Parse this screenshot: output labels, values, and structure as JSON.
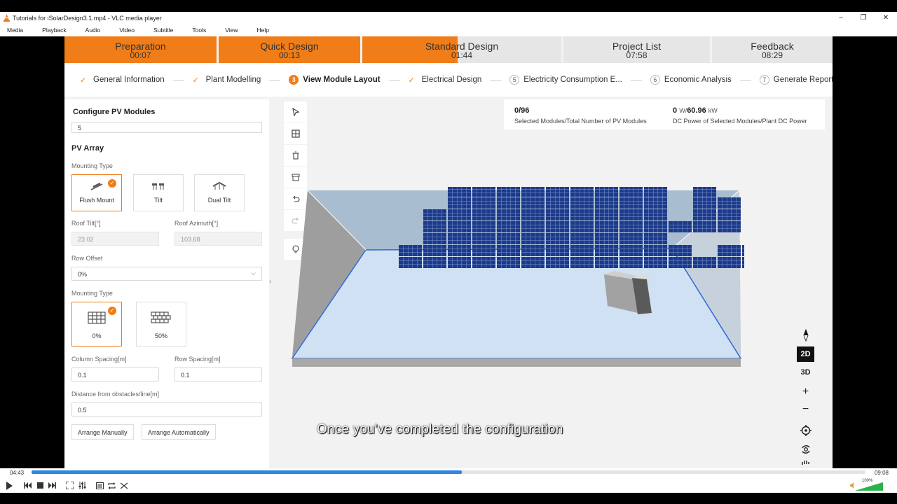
{
  "window": {
    "title": "Tutorials for iSolarDesign3.1.mp4 - VLC media player",
    "controls": [
      "–",
      "❐",
      "✕"
    ]
  },
  "menu": [
    "Media",
    "Playback",
    "Audio",
    "Video",
    "Subtitle",
    "Tools",
    "View",
    "Help"
  ],
  "phases": [
    {
      "label": "Preparation",
      "time": "00:07",
      "progress": 1.0
    },
    {
      "label": "Quick Design",
      "time": "00:13",
      "progress": 1.0
    },
    {
      "label": "Standard Design",
      "time": "01:44",
      "progress": 0.48
    },
    {
      "label": "Project List",
      "time": "07:58",
      "progress": 0
    },
    {
      "label": "Feedback",
      "time": "08:29",
      "progress": 0
    }
  ],
  "steps": [
    {
      "label": "General Information",
      "state": "done",
      "num": ""
    },
    {
      "label": "Plant Modelling",
      "state": "done",
      "num": ""
    },
    {
      "label": "View Module Layout",
      "state": "active",
      "num": "3"
    },
    {
      "label": "Electrical Design",
      "state": "done",
      "num": ""
    },
    {
      "label": "Electricity Consumption E...",
      "state": "todo",
      "num": "5"
    },
    {
      "label": "Economic Analysis",
      "state": "todo",
      "num": "6"
    },
    {
      "label": "Generate Report",
      "state": "todo",
      "num": "7"
    }
  ],
  "panel": {
    "header": "Configure PV Modules",
    "top_value": "5",
    "section": "PV Array",
    "mounting_type_label": "Mounting Type",
    "mounting_options": [
      {
        "label": "Flush Mount",
        "selected": true
      },
      {
        "label": "Tilt",
        "selected": false
      },
      {
        "label": "Dual Tilt",
        "selected": false
      }
    ],
    "roof_tilt_label": "Roof Tilt[°]",
    "roof_tilt_value": "23.02",
    "roof_azimuth_label": "Roof Azimuth[°]",
    "roof_azimuth_value": "103.68",
    "row_offset_label": "Row Offset",
    "row_offset_value": "0%",
    "mounting_type2_label": "Mounting Type",
    "offset_options": [
      {
        "label": "0%",
        "selected": true
      },
      {
        "label": "50%",
        "selected": false
      }
    ],
    "column_spacing_label": "Column Spacing[m]",
    "column_spacing_value": "0.1",
    "row_spacing_label": "Row Spacing[m]",
    "row_spacing_value": "0.1",
    "distance_label": "Distance from obstacles/line[m]",
    "distance_value": "0.5",
    "arrange_manual": "Arrange Manually",
    "arrange_auto": "Arrange Automatically"
  },
  "stats": {
    "selected": "0/96",
    "selected_desc": "Selected Modules/Total Number of PV Modules",
    "power": "0",
    "power_unit1": "W/",
    "power_total": "60.96",
    "power_unit2": "kW",
    "power_desc": "DC Power of Selected Modules/Plant DC Power"
  },
  "tools": [
    "select-icon",
    "grid-icon",
    "trash-icon",
    "box-icon",
    "undo-icon",
    "redo-icon",
    "bulb-icon"
  ],
  "view_controls": {
    "mode_2d": "2D",
    "mode_3d": "3D",
    "zoom_in": "+",
    "zoom_out": "−"
  },
  "subtitle": "Once you've completed the configuration",
  "player": {
    "elapsed": "04:43",
    "total": "09:08",
    "progress": 0.516,
    "volume": "100%",
    "volume_level": 1.0
  },
  "colors": {
    "accent": "#f07d18",
    "panel_blue": "#1d3a8a",
    "roof_top": "#a8bdd2",
    "progress": "#2e86de"
  }
}
